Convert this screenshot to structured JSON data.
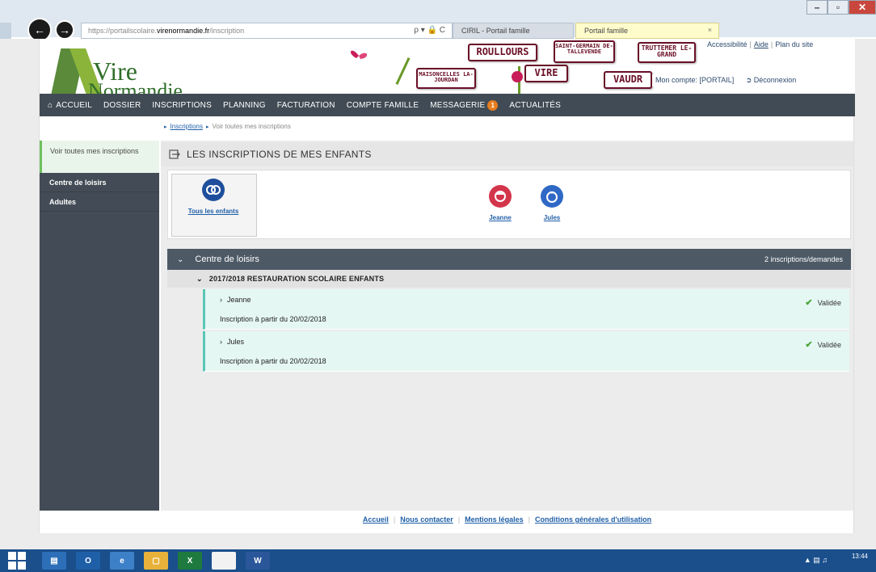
{
  "browser": {
    "url_prefix": "https://portailscolaire.",
    "url_domain": "virenormandie.fr",
    "url_path": "/inscription",
    "addr_icons": "ρ ▾ 🔒 C",
    "tabs": [
      {
        "label": "CIRIL - Portail famille"
      },
      {
        "label": "Portail famille"
      }
    ],
    "tab_close": "×",
    "win_min": "–",
    "win_max": "▫",
    "win_close": "✕"
  },
  "header": {
    "logo_line1": "Vire",
    "logo_line2": "Normandie",
    "signs": [
      "ROULLOURS",
      "SAINT-GERMAIN DE-TALLEVENDE",
      "TRUTTEMER LE-GRAND",
      "MAISONCELLES LA-JOURDAN",
      "VIRE",
      "VAUDR"
    ],
    "top_links": [
      "Accessibilité",
      "Aide",
      "Plan du site"
    ],
    "top_sep": "|",
    "account_label": "Mon compte: [PORTAIL]",
    "logout_label": "Déconnexion"
  },
  "nav": {
    "items": [
      "ACCUEIL",
      "DOSSIER",
      "INSCRIPTIONS",
      "PLANNING",
      "FACTURATION",
      "COMPTE FAMILLE",
      "MESSAGERIE",
      "ACTUALITÉS"
    ],
    "messagerie_badge": "1"
  },
  "breadcrumb": {
    "link": "Inscriptions",
    "current": "Voir toutes mes inscriptions"
  },
  "sidebar": {
    "active": "Voir toutes mes inscriptions",
    "items": [
      "Centre de loisirs",
      "Adultes"
    ]
  },
  "main": {
    "section_title": "LES INSCRIPTIONS DE MES ENFANTS",
    "children": {
      "all": "Tous les enfants",
      "kids": [
        "Jeanne",
        "Jules"
      ]
    },
    "group": {
      "title": "Centre de loisirs",
      "count": "2 inscriptions/demandes",
      "sub_title": "2017/2018 RESTAURATION SCOLAIRE ENFANTS",
      "rows": [
        {
          "name": "Jeanne",
          "date": "Inscription à partir du 20/02/2018",
          "status": "Validée"
        },
        {
          "name": "Jules",
          "date": "Inscription à partir du 20/02/2018",
          "status": "Validée"
        }
      ]
    }
  },
  "footer": {
    "links": [
      "Accueil",
      "Nous contacter",
      "Mentions légales",
      "Conditions générales d'utilisation"
    ]
  },
  "taskbar": {
    "clock": "13:44"
  },
  "colors": {
    "nav_bg": "#414b55",
    "sidebar_bg": "#434c56",
    "group_header_bg": "#4d5a66",
    "row_bg": "#e5f7f3",
    "row_accent": "#58c7b4",
    "badge": "#e87d1e",
    "check": "#4aa53a",
    "jeanne": "#d3354b",
    "jules": "#2f69c5",
    "all": "#1e4f9c"
  }
}
